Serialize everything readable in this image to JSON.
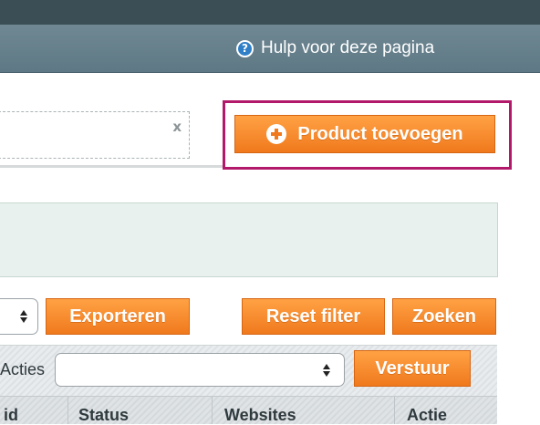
{
  "header": {
    "help_label": "Hulp voor deze pagina",
    "help_icon": "help-circle-icon"
  },
  "search": {
    "value": "",
    "clear_glyph": "x"
  },
  "actions": {
    "add_product_label": "Product toevoegen",
    "add_icon": "plus-circle-icon",
    "export_label": "Exporteren",
    "reset_filter_label": "Reset filter",
    "search_label": "Zoeken"
  },
  "massaction": {
    "label": "Acties",
    "select_value": "",
    "submit_label": "Verstuur"
  },
  "grid": {
    "columns": [
      "id",
      "Status",
      "Websites",
      "Actie"
    ]
  },
  "colors": {
    "accent_orange": "#f0791d",
    "highlight_border": "#b3196a",
    "header_bg": "#5e7885",
    "topbar_bg": "#3b4e56",
    "info_bg": "#e8f1ed"
  }
}
